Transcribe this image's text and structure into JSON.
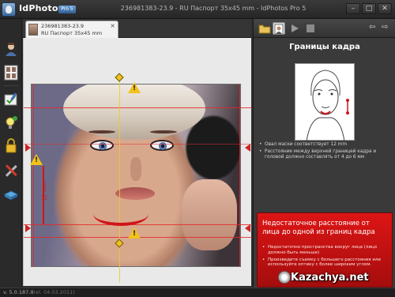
{
  "window": {
    "brand": "IdPhotos",
    "brand_tag": "Pro 5",
    "title": "236981383-23.9 - RU Паспорт 35x45 mm - IdPhotos Pro 5",
    "min": "–",
    "max": "□",
    "close": "✕"
  },
  "left_toolbar": {
    "tools": [
      "person-icon",
      "photo-sheet-icon",
      "edit-check-icon",
      "bulb-check-icon",
      "lock-icon",
      "tools-icon",
      "export-icon"
    ]
  },
  "doc_tab": {
    "line1": "236981383-23.9",
    "line2": "RU Паспорт 35x45 mm",
    "close": "×"
  },
  "canvas": {
    "measure_label": "12 mm",
    "warning_mark": "!"
  },
  "right_panel": {
    "tools": [
      "folder-icon",
      "portrait-icon",
      "play-icon",
      "stop-icon"
    ],
    "nav_back": "⇦",
    "nav_forward": "⇨",
    "heading": "Границы кадра",
    "tips": [
      "Овал маски соответствует 12 mm",
      "Расстояние между верхней границей кадра и головой должно составлять от 4 до 6 мм"
    ],
    "alert": {
      "title": "Недостаточное расстояние от лица до одной из границ кадра",
      "items": [
        "Недостаточно пространства вокруг лица (лицо должно быть меньше)",
        "Произведите съемку с большего расстояния или используйте оптику с более широким углом."
      ],
      "color": "#d51414"
    }
  },
  "status": {
    "version": "v. 5.0.187.0",
    "date": "(rel. 04.03.2011)"
  },
  "watermark": {
    "text": "Kazachya.net"
  }
}
